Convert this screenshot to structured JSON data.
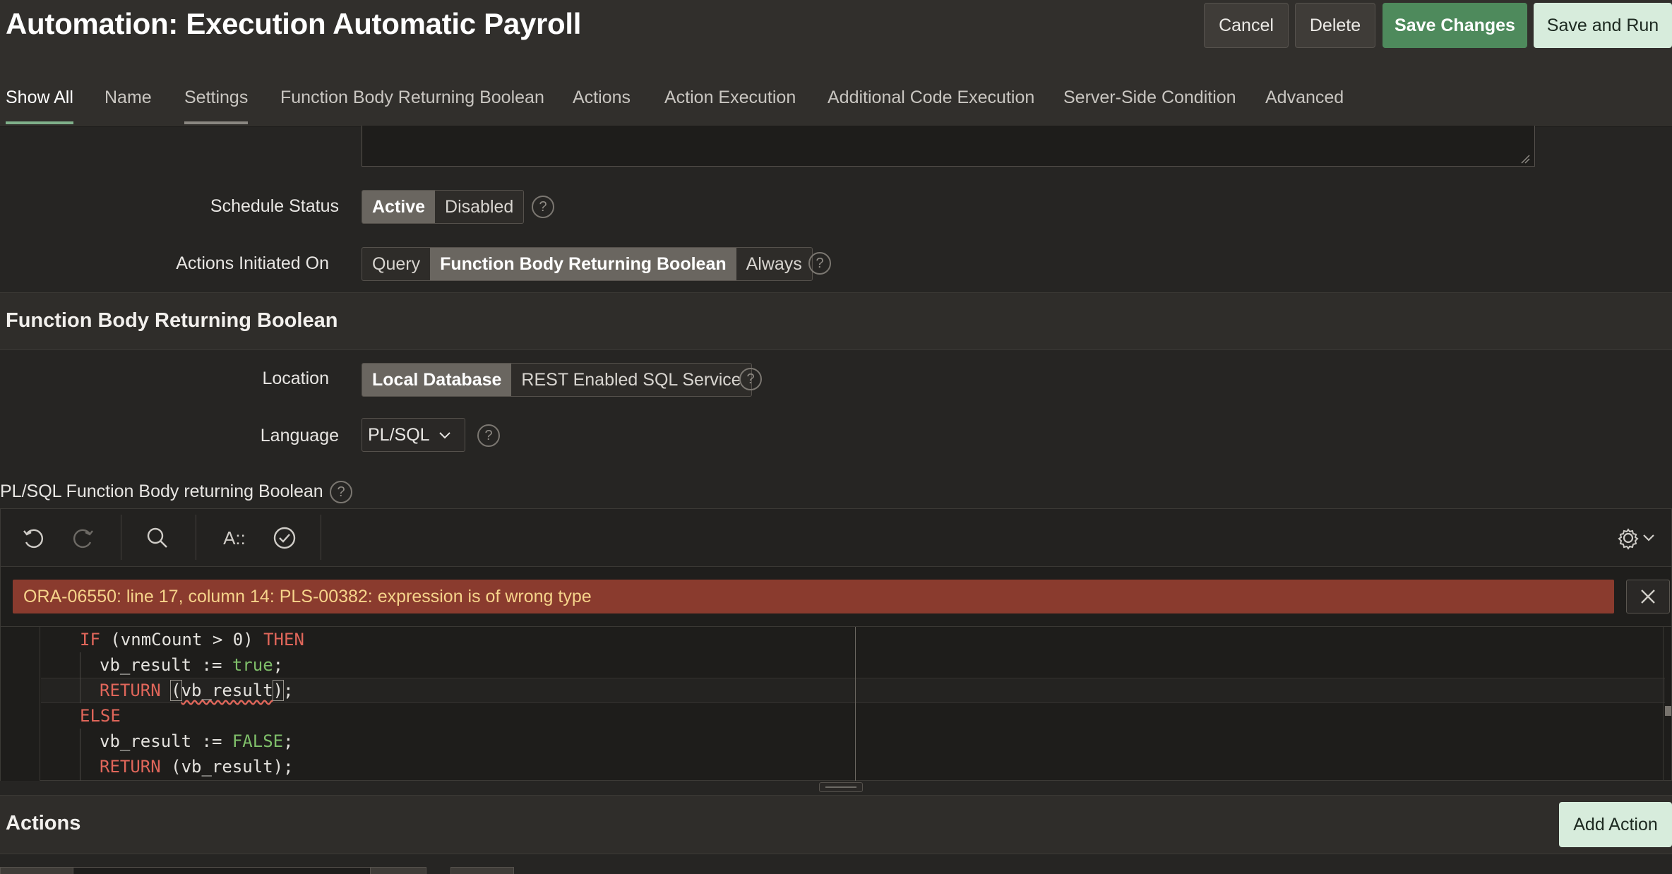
{
  "header": {
    "title": "Automation: Execution Automatic Payroll",
    "buttons": {
      "cancel": "Cancel",
      "delete": "Delete",
      "save_changes": "Save Changes",
      "save_and_run": "Save and Run"
    }
  },
  "tabs": [
    {
      "label": "Show All",
      "state": "active"
    },
    {
      "label": "Name"
    },
    {
      "label": "Settings",
      "state": "hover"
    },
    {
      "label": "Function Body Returning Boolean"
    },
    {
      "label": "Actions"
    },
    {
      "label": "Action Execution"
    },
    {
      "label": "Additional Code Execution"
    },
    {
      "label": "Server-Side Condition"
    },
    {
      "label": "Advanced"
    }
  ],
  "settings": {
    "schedule_status": {
      "label": "Schedule Status",
      "options": [
        "Active",
        "Disabled"
      ],
      "selected": "Active"
    },
    "actions_initiated_on": {
      "label": "Actions Initiated On",
      "options": [
        "Query",
        "Function Body Returning Boolean",
        "Always"
      ],
      "selected": "Function Body Returning Boolean"
    }
  },
  "function_body": {
    "section_title": "Function Body Returning Boolean",
    "location": {
      "label": "Location",
      "options": [
        "Local Database",
        "REST Enabled SQL Service"
      ],
      "selected": "Local Database"
    },
    "language": {
      "label": "Language",
      "value": "PL/SQL"
    },
    "editor": {
      "label": "PL/SQL Function Body returning Boolean",
      "error": "ORA-06550: line 17, column 14: PLS-00382: expression is of wrong type",
      "code": {
        "l1_if": "IF",
        "l1_cond": " (vnmCount > 0) ",
        "l1_then": "THEN",
        "l2_var": "vb_result := ",
        "l2_val": "true",
        "l2_end": ";",
        "l3_ret": "RETURN",
        "l3_open": "(",
        "l3_arg": "vb_result",
        "l3_close": ")",
        "l3_end": ";",
        "l4_else": "ELSE",
        "l5_var": "vb_result := ",
        "l5_val": "FALSE",
        "l5_end": ";",
        "l6_ret": "RETURN",
        "l6_rest": " (vb_result);"
      }
    }
  },
  "actions_section": {
    "title": "Actions",
    "add_button": "Add Action"
  },
  "icons": {
    "help": "?",
    "undo": "undo-icon",
    "redo": "redo-icon",
    "search": "search-icon",
    "format": "A::",
    "validate": "check-circle-icon",
    "settings": "gear-icon",
    "close": "close-icon"
  },
  "colors": {
    "primary_button": "#4e8a5c",
    "secondary_button": "#d7ecdc",
    "error_bg": "#8a3b2e",
    "error_text": "#f6d38a",
    "keyword": "#e0665a",
    "literal": "#7fbf6a"
  }
}
